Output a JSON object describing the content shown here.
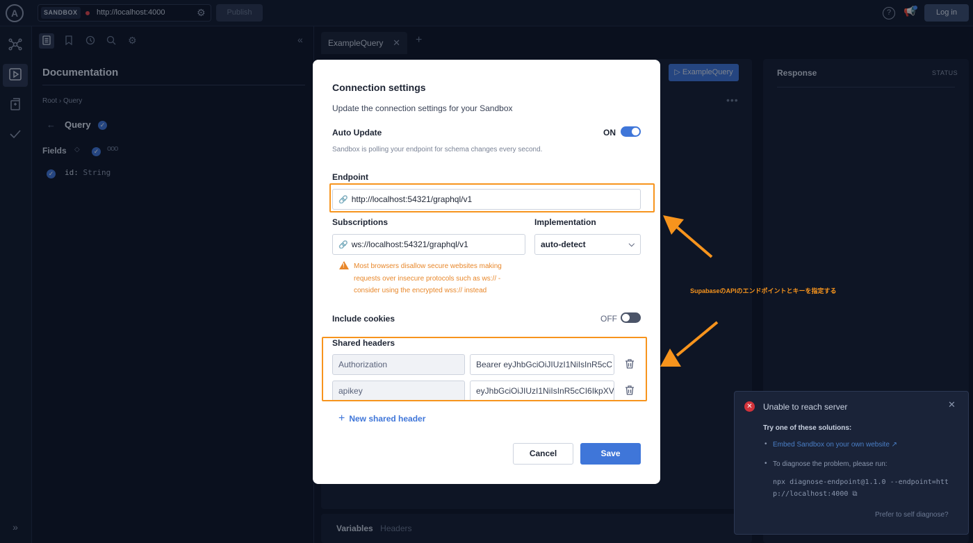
{
  "topbar": {
    "logo": "A",
    "sandbox_tag": "SANDBOX",
    "url": "http://localhost:4000",
    "publish_label": "Publish",
    "help_glyph": "?",
    "login_label": "Log in"
  },
  "docs": {
    "title": "Documentation",
    "breadcrumb": "Root › Query",
    "query_heading": "Query",
    "fields_heading": "Fields",
    "field_name": "id:",
    "field_type": "String"
  },
  "tabs": [
    {
      "label": "ExampleQuery"
    }
  ],
  "editor": {
    "run_label": "▷ ExampleQuery",
    "variables_label": "Variables",
    "headers_label": "Headers"
  },
  "response": {
    "title": "Response",
    "status_label": "STATUS"
  },
  "modal": {
    "title": "Connection settings",
    "subtitle": "Update the connection settings for your Sandbox",
    "auto_update_label": "Auto Update",
    "auto_update_state": "ON",
    "auto_update_hint": "Sandbox is polling your endpoint for schema changes every second.",
    "endpoint_label": "Endpoint",
    "endpoint_value": "http://localhost:54321/graphql/v1",
    "subscriptions_label": "Subscriptions",
    "subscriptions_value": "ws://localhost:54321/graphql/v1",
    "implementation_label": "Implementation",
    "implementation_value": "auto-detect",
    "warning_text": "Most browsers disallow secure websites making requests over insecure protocols such as ws:// - consider using the encrypted wss:// instead",
    "include_cookies_label": "Include cookies",
    "include_cookies_state": "OFF",
    "shared_headers_label": "Shared headers",
    "headers": [
      {
        "key": "Authorization",
        "value": "Bearer eyJhbGciOiJIUzI1NiIsInR5cC"
      },
      {
        "key": "apikey",
        "value": "eyJhbGciOiJIUzI1NiIsInR5cCI6IkpXV"
      }
    ],
    "new_header_label": "New shared header",
    "cancel_label": "Cancel",
    "save_label": "Save"
  },
  "toast": {
    "title": "Unable to reach server",
    "subtitle": "Try one of these solutions:",
    "link_text": "Embed Sandbox on your own website",
    "diagnose_text": "To diagnose the problem, please run:",
    "command": "npx diagnose-endpoint@1.1.0 --endpoint=http://localhost:4000",
    "prefer_text": "Prefer to self diagnose?"
  },
  "annotation": {
    "text": "SupabaseのAPIのエンドポイントとキーを指定する",
    "color": "#f7941d"
  },
  "colors": {
    "accent": "#3f76d9",
    "warning": "#e8872a",
    "error": "#d2333b",
    "background": "#0d1527"
  }
}
